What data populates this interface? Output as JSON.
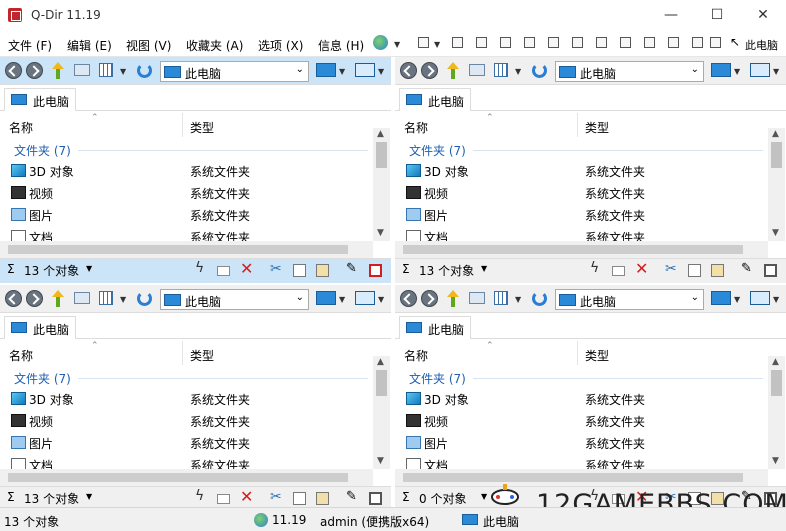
{
  "window": {
    "title": "Q-Dir 11.19",
    "minimize": "—",
    "maximize": "☐",
    "close": "✕"
  },
  "menu": {
    "items": [
      "文件 (F)",
      "编辑 (E)",
      "视图 (V)",
      "收藏夹 (A)",
      "选项 (X)",
      "信息 (H)"
    ],
    "right_label": "此电脑"
  },
  "panes": [
    {
      "active": true,
      "address": "此电脑",
      "tab": "此电脑",
      "col_name": "名称",
      "col_type": "类型",
      "group": "文件夹 (7)",
      "rows": [
        {
          "name": "3D 对象",
          "type": "系统文件夹",
          "icon": "cube-icon"
        },
        {
          "name": "视频",
          "type": "系统文件夹",
          "icon": "video-icon"
        },
        {
          "name": "图片",
          "type": "系统文件夹",
          "icon": "picture-icon"
        },
        {
          "name": "文档",
          "type": "系统文件夹",
          "icon": "document-icon"
        }
      ],
      "count": "13 个对象"
    },
    {
      "active": false,
      "address": "此电脑",
      "tab": "此电脑",
      "col_name": "名称",
      "col_type": "类型",
      "group": "文件夹 (7)",
      "rows": [
        {
          "name": "3D 对象",
          "type": "系统文件夹",
          "icon": "cube-icon"
        },
        {
          "name": "视频",
          "type": "系统文件夹",
          "icon": "video-icon"
        },
        {
          "name": "图片",
          "type": "系统文件夹",
          "icon": "picture-icon"
        },
        {
          "name": "文档",
          "type": "系统文件夹",
          "icon": "document-icon"
        }
      ],
      "count": "13 个对象"
    },
    {
      "active": false,
      "address": "此电脑",
      "tab": "此电脑",
      "col_name": "名称",
      "col_type": "类型",
      "group": "文件夹 (7)",
      "rows": [
        {
          "name": "3D 对象",
          "type": "系统文件夹",
          "icon": "cube-icon"
        },
        {
          "name": "视频",
          "type": "系统文件夹",
          "icon": "video-icon"
        },
        {
          "name": "图片",
          "type": "系统文件夹",
          "icon": "picture-icon"
        },
        {
          "name": "文档",
          "type": "系统文件夹",
          "icon": "document-icon"
        }
      ],
      "count": "13 个对象"
    },
    {
      "active": false,
      "address": "此电脑",
      "tab": "此电脑",
      "col_name": "名称",
      "col_type": "类型",
      "group": "文件夹 (7)",
      "rows": [
        {
          "name": "3D 对象",
          "type": "系统文件夹",
          "icon": "cube-icon"
        },
        {
          "name": "视频",
          "type": "系统文件夹",
          "icon": "video-icon"
        },
        {
          "name": "图片",
          "type": "系统文件夹",
          "icon": "picture-icon"
        },
        {
          "name": "文档",
          "type": "系统文件夹",
          "icon": "document-icon"
        }
      ],
      "count": "0 个对象"
    }
  ],
  "status": {
    "count": "13 个对象",
    "version": "11.19",
    "user": "admin (便携版x64)",
    "location": "此电脑"
  },
  "watermark": "12GAMEBBS.COM",
  "colors": {
    "active_pane": "#cce4f7",
    "inactive_pane": "#f0f0f0",
    "group_text": "#1e5fb0",
    "delete_red": "#d21e1e"
  }
}
